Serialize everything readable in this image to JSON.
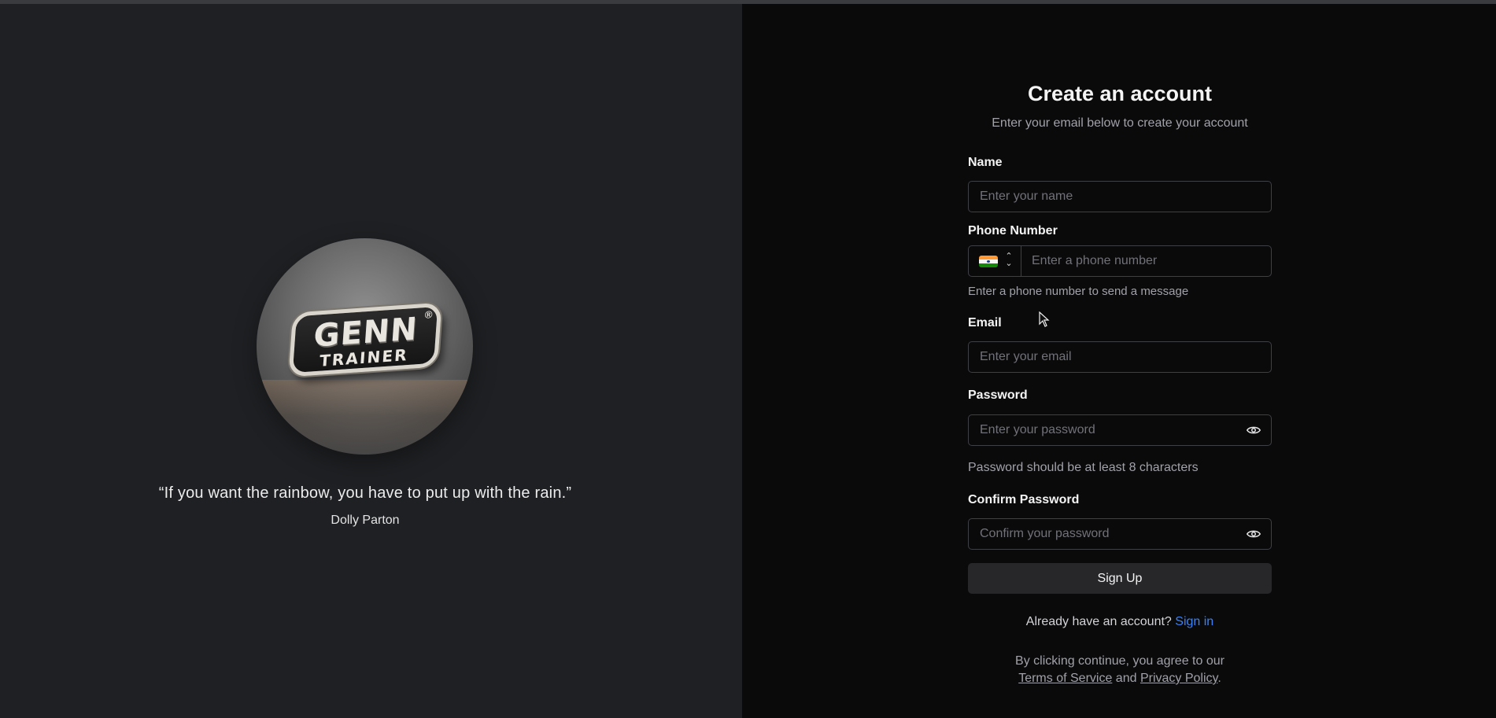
{
  "left": {
    "logo": {
      "word": "GENN",
      "sub": "TRAINER",
      "reg": "®"
    },
    "quote": "“If you want the rainbow, you have to put up with the rain.”",
    "author": "Dolly Parton"
  },
  "form": {
    "title": "Create an account",
    "subtitle": "Enter your email below to create your account",
    "name": {
      "label": "Name",
      "placeholder": "Enter your name"
    },
    "phone": {
      "label": "Phone Number",
      "placeholder": "Enter a phone number",
      "country_flag": "india-flag-icon",
      "hint": "Enter a phone number to send a message"
    },
    "email": {
      "label": "Email",
      "placeholder": "Enter your email"
    },
    "password": {
      "label": "Password",
      "placeholder": "Enter your password",
      "hint": "Password should be at least 8 characters"
    },
    "confirm": {
      "label": "Confirm Password",
      "placeholder": "Confirm your password"
    },
    "signup_label": "Sign Up",
    "already_text": "Already have an account?",
    "signin_label": "Sign in",
    "terms_prefix": "By clicking continue, you agree to our",
    "terms_link": "Terms of Service",
    "terms_and": "and",
    "privacy_link": "Privacy Policy",
    "terms_suffix": "."
  },
  "colors": {
    "left_bg": "#1f2023",
    "right_bg": "#0a0a0a",
    "link": "#3b82f6",
    "button_bg": "#27272a"
  }
}
